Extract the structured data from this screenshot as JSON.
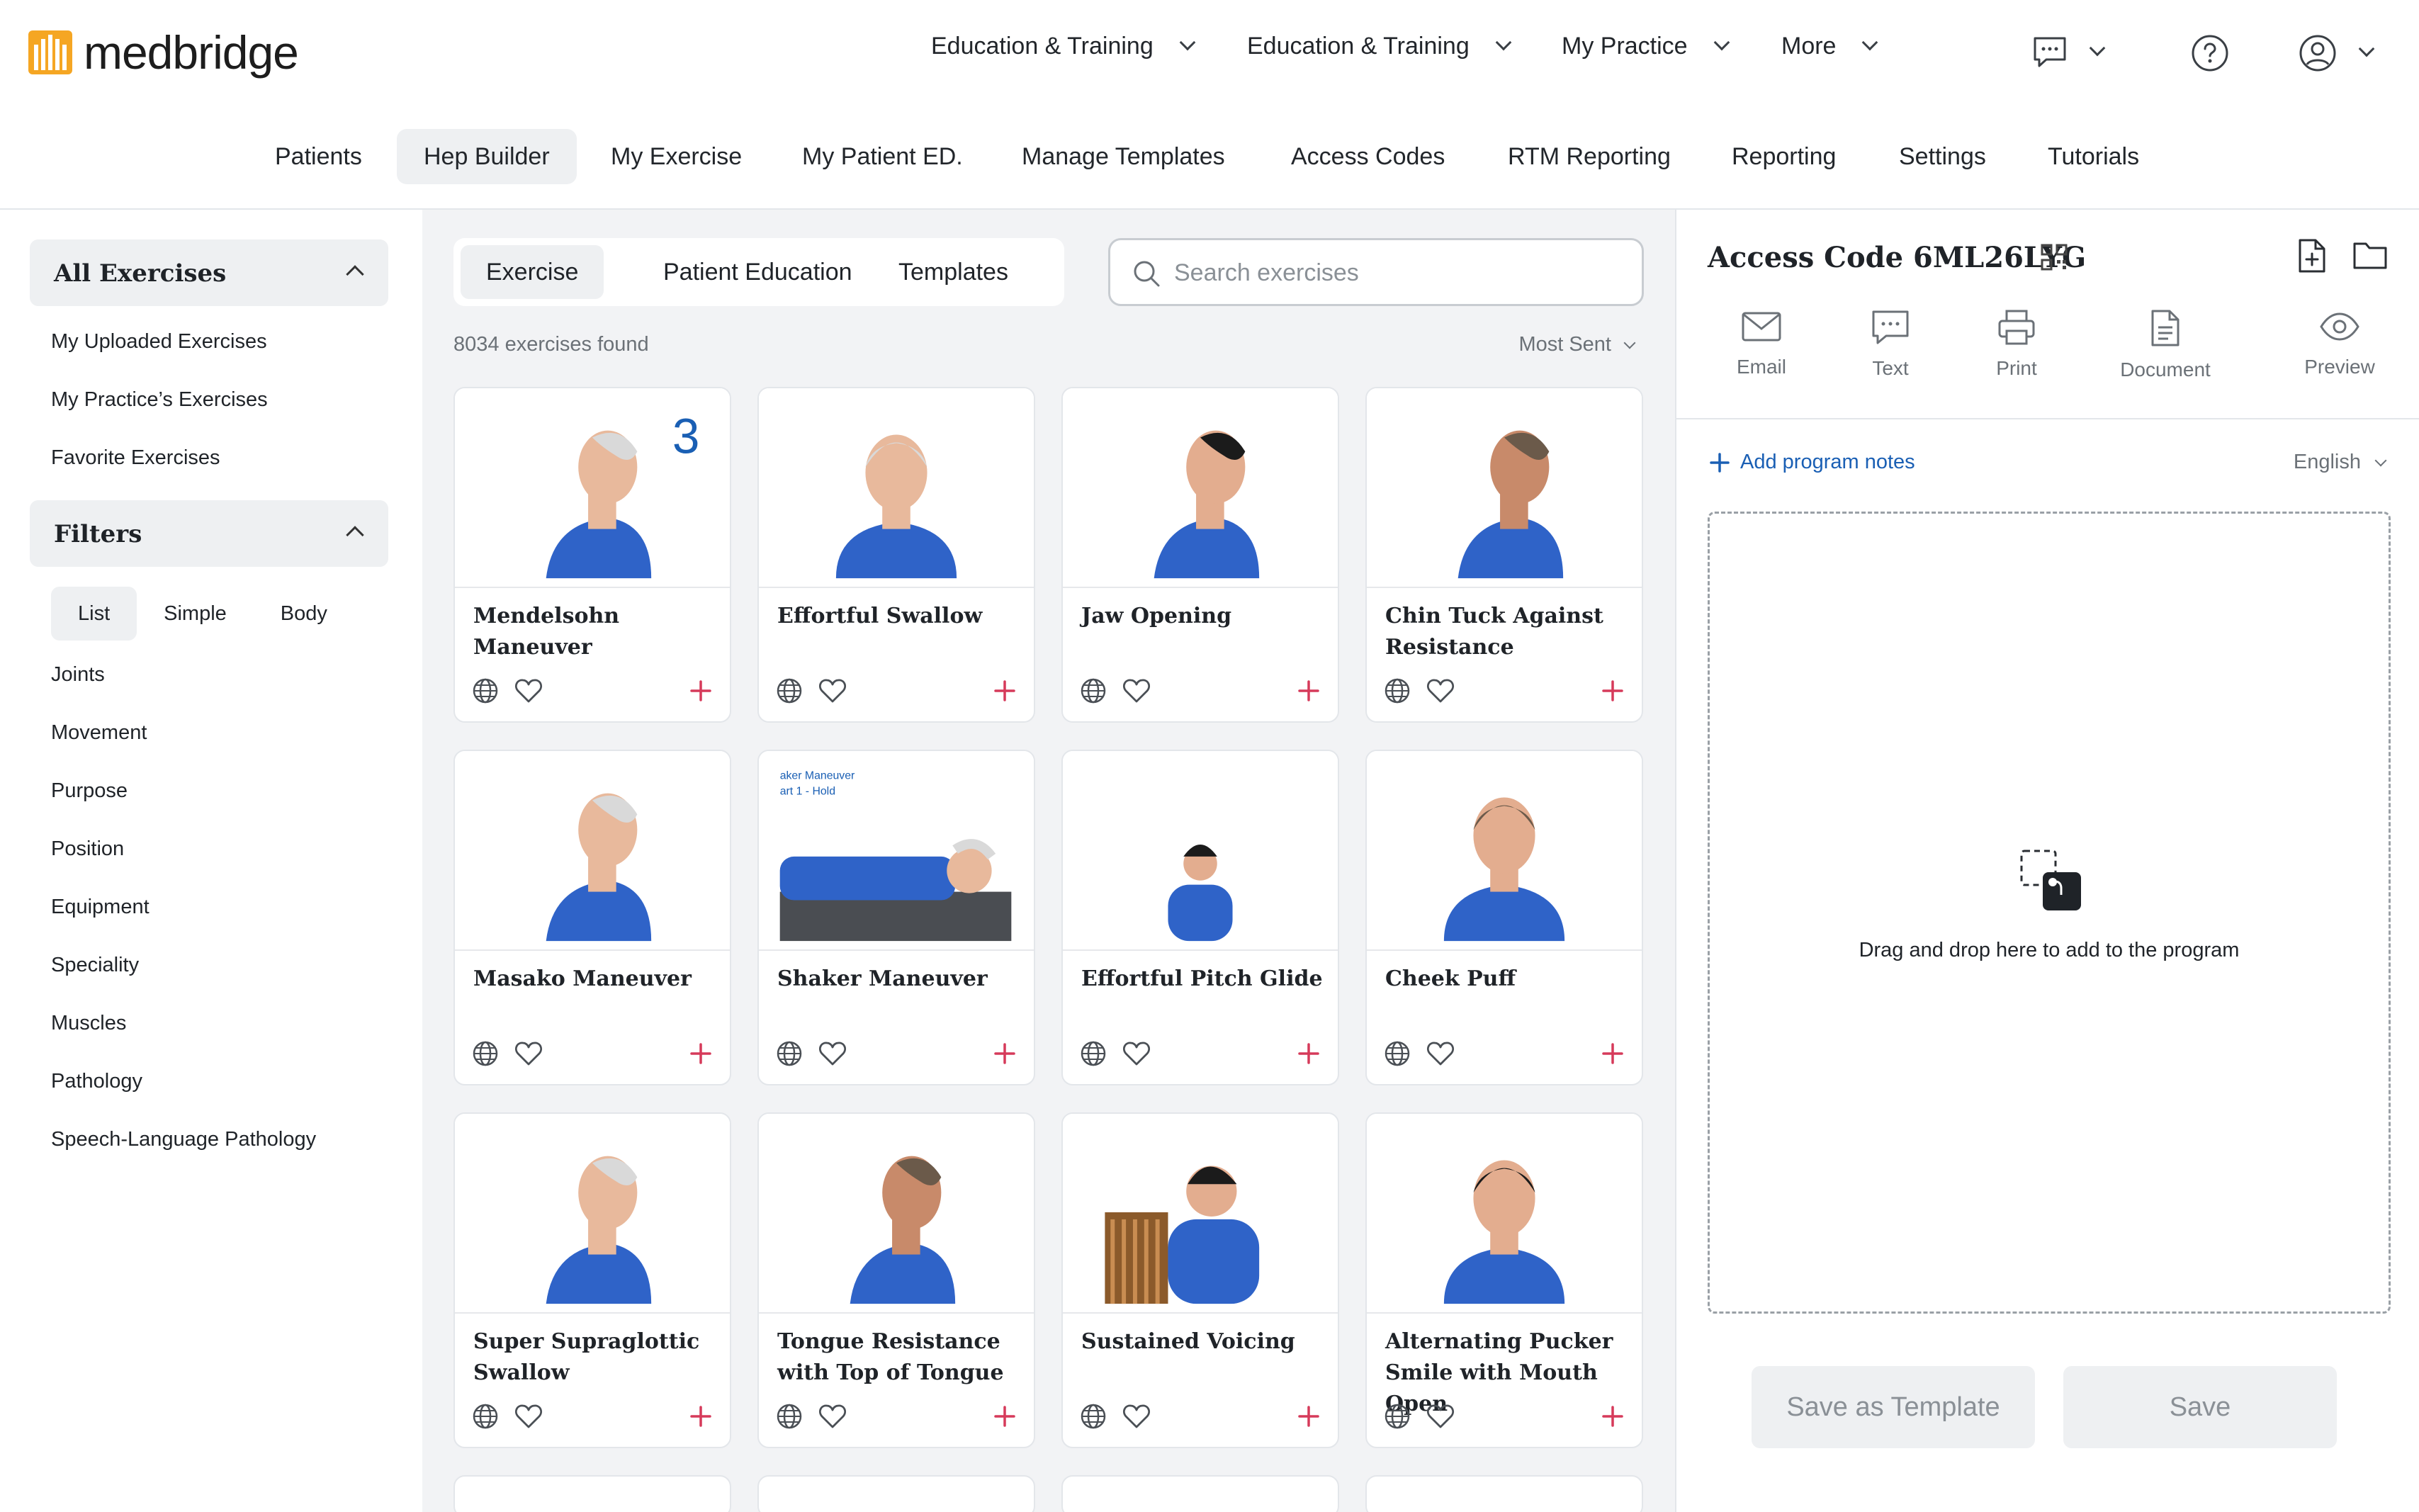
{
  "brand": {
    "name": "medbridge",
    "color": "#f5a623"
  },
  "top_nav": [
    {
      "label": "Education & Training"
    },
    {
      "label": "Education & Training"
    },
    {
      "label": "My Practice"
    },
    {
      "label": "More"
    }
  ],
  "sub_nav": [
    {
      "label": "Patients"
    },
    {
      "label": "Hep Builder",
      "active": true
    },
    {
      "label": "My Exercise"
    },
    {
      "label": "My Patient ED."
    },
    {
      "label": "Manage Templates"
    },
    {
      "label": "Access Codes"
    },
    {
      "label": "RTM Reporting"
    },
    {
      "label": "Reporting"
    },
    {
      "label": "Settings"
    },
    {
      "label": "Tutorials"
    }
  ],
  "sidebar": {
    "all_exercises": {
      "title": "All Exercises",
      "items": [
        "My Uploaded Exercises",
        "My Practice’s Exercises",
        "Favorite Exercises"
      ]
    },
    "filters": {
      "title": "Filters",
      "modes": [
        "List",
        "Simple",
        "Body"
      ],
      "active_mode": "List",
      "items": [
        "Joints",
        "Movement",
        "Purpose",
        "Position",
        "Equipment",
        "Speciality",
        "Muscles",
        "Pathology",
        "Speech-Language Pathology"
      ]
    }
  },
  "main": {
    "tabs": [
      "Exercise",
      "Patient Education",
      "Templates"
    ],
    "active_tab": "Exercise",
    "search_placeholder": "Search exercises",
    "count_text": "8034 exercises found",
    "sort_label": "Most Sent",
    "exercises": [
      {
        "title": "Mendelsohn Maneuver",
        "overlay": "3"
      },
      {
        "title": "Effortful Swallow"
      },
      {
        "title": "Jaw Opening"
      },
      {
        "title": "Chin Tuck Against Resistance"
      },
      {
        "title": "Masako Maneuver"
      },
      {
        "title": "Shaker Maneuver",
        "overlay_lines": [
          "aker Maneuver",
          "art 1 - Hold"
        ]
      },
      {
        "title": "Effortful Pitch Glide"
      },
      {
        "title": "Cheek Puff"
      },
      {
        "title": "Super Supraglottic Swallow"
      },
      {
        "title": "Tongue Resistance with Top of Tongue"
      },
      {
        "title": "Sustained Voicing"
      },
      {
        "title": "Alternating Pucker Smile with Mouth Open"
      }
    ]
  },
  "program": {
    "access_code_label": "Access Code 6ML26LYG",
    "actions": [
      "Email",
      "Text",
      "Print",
      "Document",
      "Preview"
    ],
    "add_notes_label": "Add program notes",
    "language": "English",
    "drop_text": "Drag and drop here to add to the program",
    "save_template_label": "Save as Template",
    "save_label": "Save"
  },
  "colors": {
    "accent": "#1a5fb4",
    "plus": "#d63a5a",
    "shirt": "#2f63c8"
  }
}
